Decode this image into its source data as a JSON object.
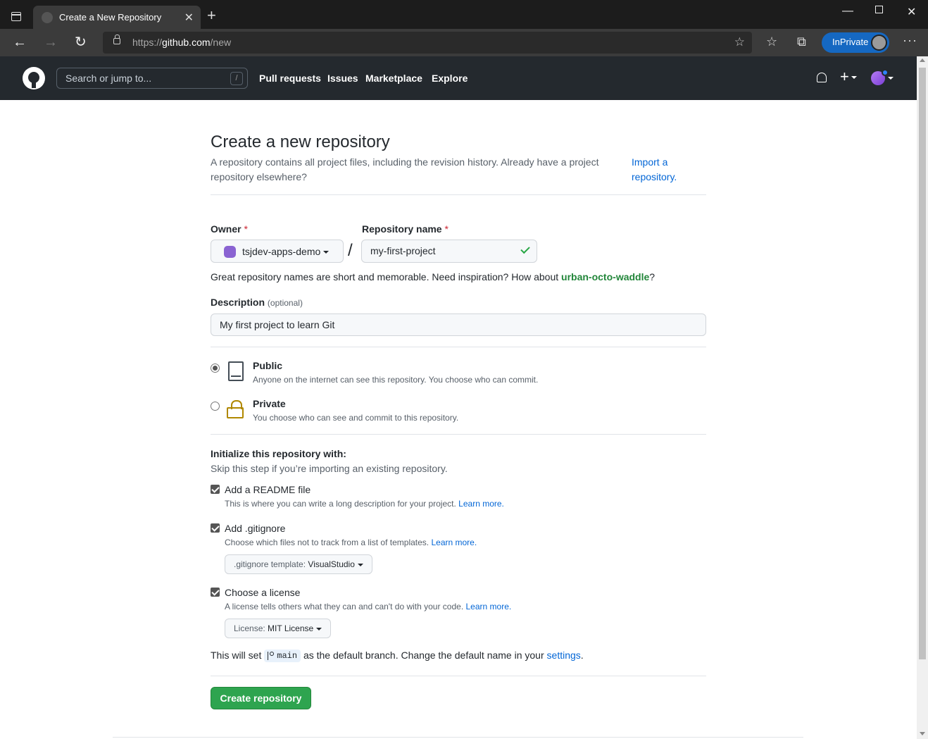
{
  "browser": {
    "tab_title": "Create a New Repository",
    "url_prefix": "https://",
    "url_host": "github.com",
    "url_path": "/new",
    "inprivate_label": "InPrivate"
  },
  "gh_header": {
    "search_placeholder": "Search or jump to...",
    "search_key": "/",
    "nav": [
      "Pull requests",
      "Issues",
      "Marketplace",
      "Explore"
    ]
  },
  "page": {
    "title": "Create a new repository",
    "description": "A repository contains all project files, including the revision history. Already have a project repository elsewhere?",
    "import_link": "Import a repository."
  },
  "form": {
    "owner_label": "Owner",
    "owner_value": "tsjdev-apps-demo",
    "repo_name_label": "Repository name",
    "repo_name_value": "my-first-project",
    "required_mark": "*",
    "separator": "/",
    "hint_text": "Great repository names are short and memorable. Need inspiration? How about",
    "hint_suggestion": "urban-octo-waddle",
    "hint_end": "?",
    "description_label": "Description",
    "description_optional": "(optional)",
    "description_value": "My first project to learn Git"
  },
  "visibility": {
    "public_title": "Public",
    "public_desc": "Anyone on the internet can see this repository. You choose who can commit.",
    "private_title": "Private",
    "private_desc": "You choose who can see and commit to this repository.",
    "selected": "public"
  },
  "init": {
    "heading": "Initialize this repository with:",
    "subheading": "Skip this step if you’re importing an existing repository.",
    "readme_label": "Add a README file",
    "readme_desc": "This is where you can write a long description for your project.",
    "gitignore_label": "Add .gitignore",
    "gitignore_desc": "Choose which files not to track from a list of templates.",
    "gitignore_select_prefix": ".gitignore template:",
    "gitignore_select_value": "VisualStudio",
    "license_label": "Choose a license",
    "license_desc": "A license tells others what they can and can't do with your code.",
    "license_select_prefix": "License:",
    "license_select_value": "MIT License",
    "learn_more": "Learn more.",
    "branch_text_before": "This will set",
    "branch_name": "main",
    "branch_text_after": "as the default branch. Change the default name in your",
    "settings_link": "settings",
    "branch_text_end": "."
  },
  "actions": {
    "create_button": "Create repository"
  }
}
